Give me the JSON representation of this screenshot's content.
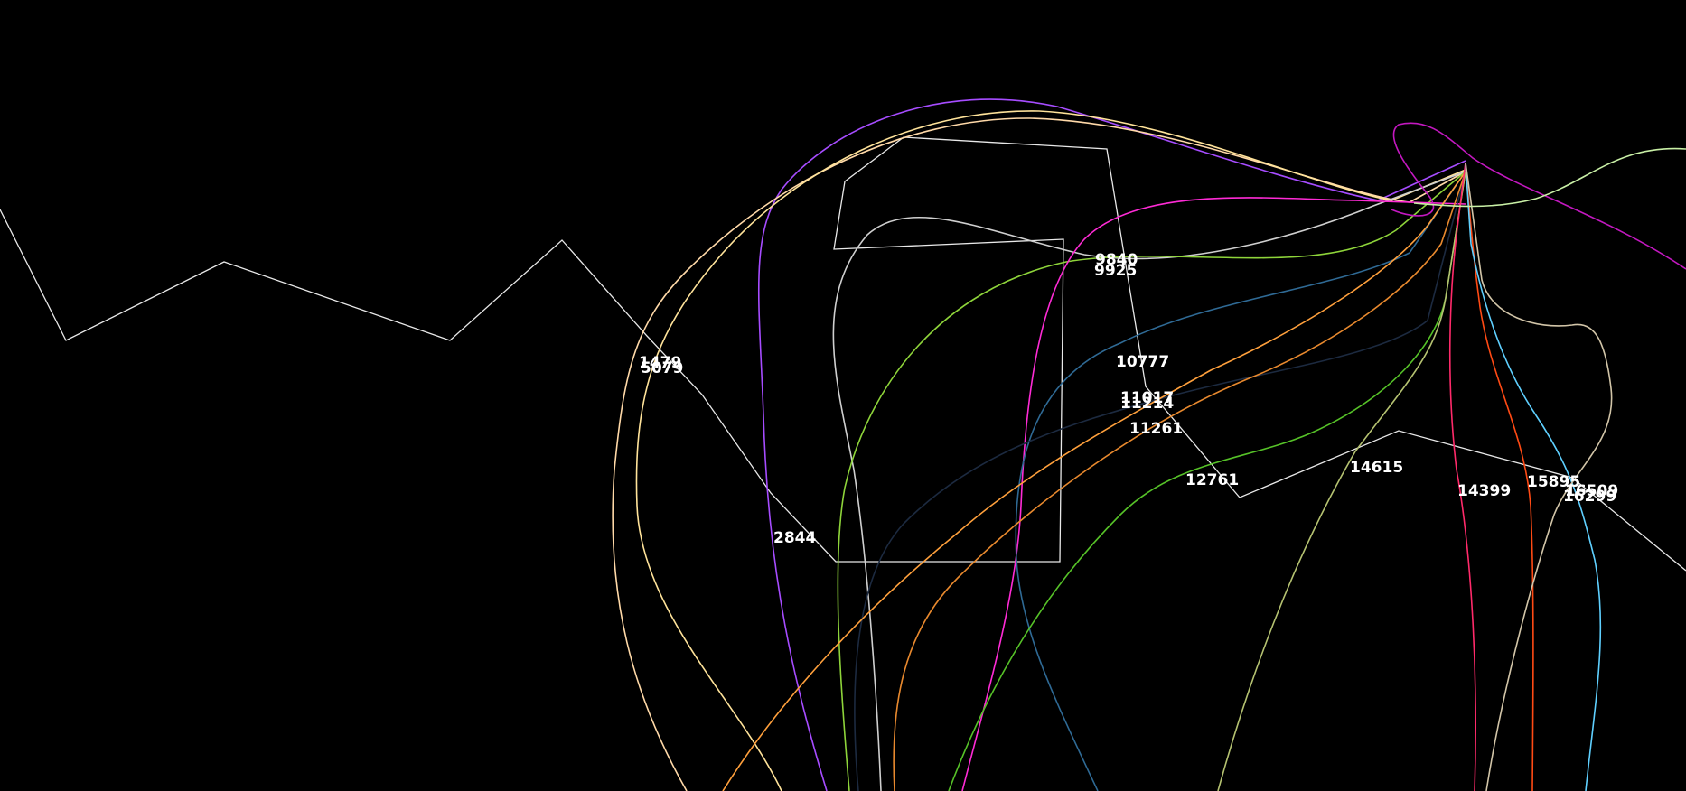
{
  "labels": [
    "1479",
    "5079",
    "2844",
    "9840",
    "9925",
    "10777",
    "11017",
    "11214",
    "11261",
    "12761",
    "14615",
    "14399",
    "15895",
    "16509",
    "16299"
  ],
  "curve_colors": {
    "violet": "#a64cff",
    "cream": "#ffd9a8",
    "peach": "#ffe39a",
    "silver": "#cfcfcf",
    "lime": "#8ed43a",
    "magenta": "#ff2bd6",
    "steel_blue": "#2f6a95",
    "navy": "#1c2a40",
    "orange": "#ffa03c",
    "dark_orange": "#e8892e",
    "green": "#56c228",
    "khaki": "#b5c271",
    "crimson": "#ff2a6a",
    "red_orange": "#ff4a14",
    "sky": "#5fd0ff",
    "tan": "#d2c5a8",
    "purple": "#c318c0",
    "mint": "#c9f0a6"
  },
  "route_color": "#e8e8e8",
  "background": "#000000"
}
